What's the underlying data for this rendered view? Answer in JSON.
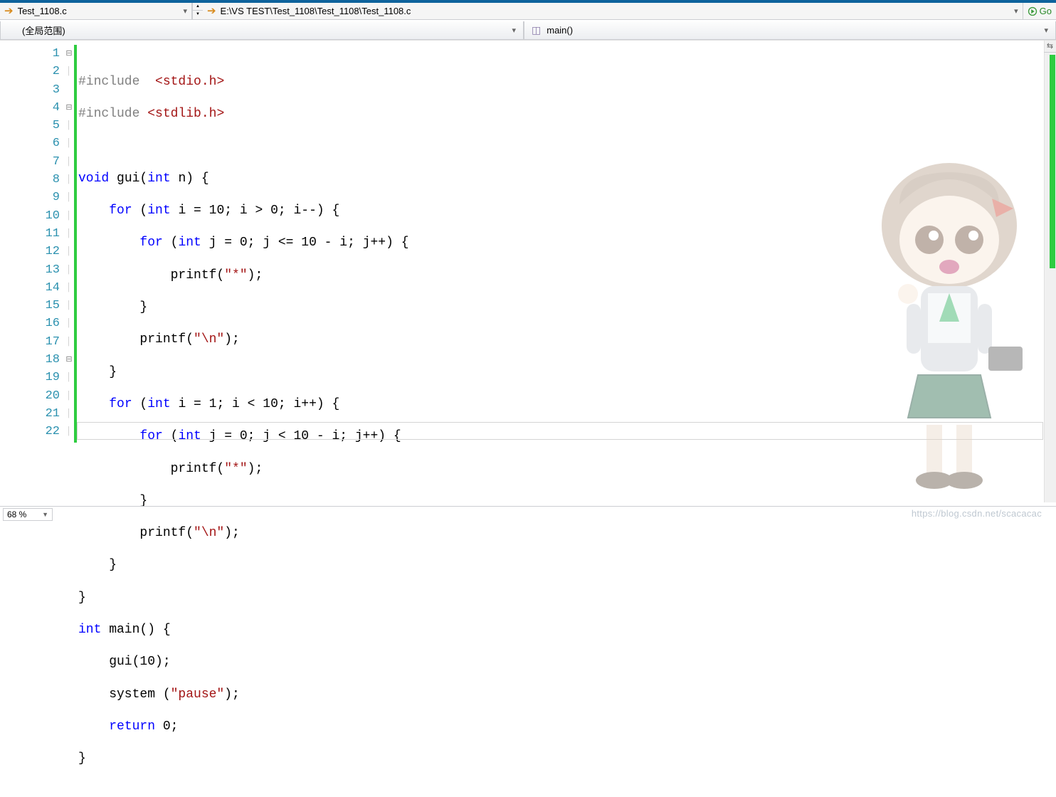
{
  "breadcrumb": {
    "file": "Test_1108.c",
    "path": "E:\\VS TEST\\Test_1108\\Test_1108\\Test_1108.c",
    "go_label": "Go"
  },
  "scope": {
    "left": "(全局范围)",
    "right": "main()"
  },
  "gutter": {
    "lines": [
      "1",
      "2",
      "3",
      "4",
      "5",
      "6",
      "7",
      "8",
      "9",
      "10",
      "11",
      "12",
      "13",
      "14",
      "15",
      "16",
      "17",
      "18",
      "19",
      "20",
      "21",
      "22"
    ]
  },
  "fold": {
    "marks": [
      "⊟",
      "│",
      "",
      "⊟",
      "│",
      "│",
      "│",
      "│",
      "│",
      "│",
      "│",
      "│",
      "│",
      "│",
      "│",
      "│",
      "│",
      "⊟",
      "│",
      "│",
      "│",
      "│"
    ]
  },
  "code": {
    "l1": {
      "pp": "#include",
      "sp": "  ",
      "inc": "<stdio.h>"
    },
    "l2": {
      "pp": "#include",
      "sp": " ",
      "inc": "<stdlib.h>"
    },
    "l4": {
      "kw1": "void",
      "fn": " gui(",
      "kw2": "int",
      "rest": " n) {"
    },
    "l5": {
      "txt": "    ",
      "kw": "for",
      "rest1": " (",
      "kw2": "int",
      "rest2": " i = 10; i > 0; i--) {"
    },
    "l6": {
      "txt": "        ",
      "kw": "for",
      "rest1": " (",
      "kw2": "int",
      "rest2": " j = 0; j <= 10 - i; j++) {"
    },
    "l7": {
      "txt": "            printf(",
      "str": "\"*\"",
      "rest": ");"
    },
    "l8": {
      "txt": "        }"
    },
    "l9": {
      "txt": "        printf(",
      "str": "\"\\n\"",
      "rest": ");"
    },
    "l10": {
      "txt": "    }"
    },
    "l11": {
      "txt": "    ",
      "kw": "for",
      "rest1": " (",
      "kw2": "int",
      "rest2": " i = 1; i < 10; i++) {"
    },
    "l12": {
      "txt": "        ",
      "kw": "for",
      "rest1": " (",
      "kw2": "int",
      "rest2": " j = 0; j < 10 - i; j++) {"
    },
    "l13": {
      "txt": "            printf(",
      "str": "\"*\"",
      "rest": ");"
    },
    "l14": {
      "txt": "        }"
    },
    "l15": {
      "txt": "        printf(",
      "str": "\"\\n\"",
      "rest": ");"
    },
    "l16": {
      "txt": "    }"
    },
    "l17": {
      "txt": "}"
    },
    "l18": {
      "kw1": "int",
      "fn": " main() {"
    },
    "l19": {
      "txt": "    gui(10);"
    },
    "l20": {
      "txt": "    system (",
      "str": "\"pause\"",
      "rest": ");"
    },
    "l21": {
      "txt": "    ",
      "kw": "return",
      "rest": " 0;"
    },
    "l22": {
      "txt": "}"
    }
  },
  "zoom": {
    "value": "68 %"
  },
  "watermark": "https://blog.csdn.net/scacacac"
}
